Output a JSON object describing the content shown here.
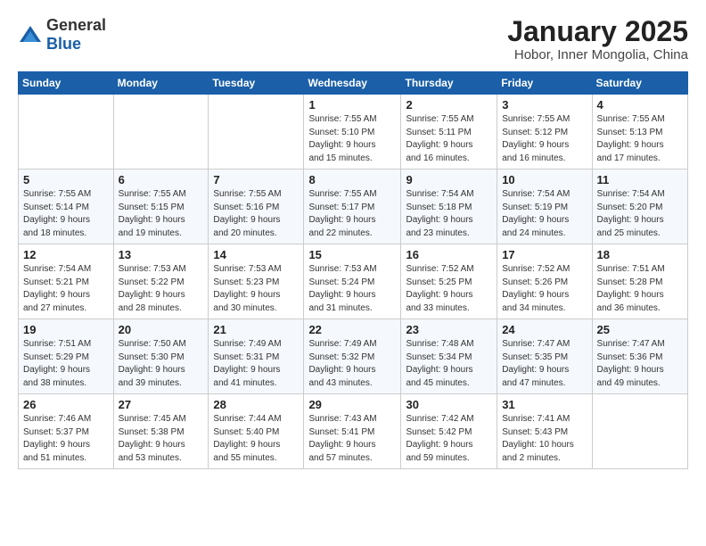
{
  "header": {
    "logo_general": "General",
    "logo_blue": "Blue",
    "title": "January 2025",
    "subtitle": "Hobor, Inner Mongolia, China"
  },
  "calendar": {
    "days_of_week": [
      "Sunday",
      "Monday",
      "Tuesday",
      "Wednesday",
      "Thursday",
      "Friday",
      "Saturday"
    ],
    "weeks": [
      [
        {
          "day": "",
          "info": ""
        },
        {
          "day": "",
          "info": ""
        },
        {
          "day": "",
          "info": ""
        },
        {
          "day": "1",
          "info": "Sunrise: 7:55 AM\nSunset: 5:10 PM\nDaylight: 9 hours\nand 15 minutes."
        },
        {
          "day": "2",
          "info": "Sunrise: 7:55 AM\nSunset: 5:11 PM\nDaylight: 9 hours\nand 16 minutes."
        },
        {
          "day": "3",
          "info": "Sunrise: 7:55 AM\nSunset: 5:12 PM\nDaylight: 9 hours\nand 16 minutes."
        },
        {
          "day": "4",
          "info": "Sunrise: 7:55 AM\nSunset: 5:13 PM\nDaylight: 9 hours\nand 17 minutes."
        }
      ],
      [
        {
          "day": "5",
          "info": "Sunrise: 7:55 AM\nSunset: 5:14 PM\nDaylight: 9 hours\nand 18 minutes."
        },
        {
          "day": "6",
          "info": "Sunrise: 7:55 AM\nSunset: 5:15 PM\nDaylight: 9 hours\nand 19 minutes."
        },
        {
          "day": "7",
          "info": "Sunrise: 7:55 AM\nSunset: 5:16 PM\nDaylight: 9 hours\nand 20 minutes."
        },
        {
          "day": "8",
          "info": "Sunrise: 7:55 AM\nSunset: 5:17 PM\nDaylight: 9 hours\nand 22 minutes."
        },
        {
          "day": "9",
          "info": "Sunrise: 7:54 AM\nSunset: 5:18 PM\nDaylight: 9 hours\nand 23 minutes."
        },
        {
          "day": "10",
          "info": "Sunrise: 7:54 AM\nSunset: 5:19 PM\nDaylight: 9 hours\nand 24 minutes."
        },
        {
          "day": "11",
          "info": "Sunrise: 7:54 AM\nSunset: 5:20 PM\nDaylight: 9 hours\nand 25 minutes."
        }
      ],
      [
        {
          "day": "12",
          "info": "Sunrise: 7:54 AM\nSunset: 5:21 PM\nDaylight: 9 hours\nand 27 minutes."
        },
        {
          "day": "13",
          "info": "Sunrise: 7:53 AM\nSunset: 5:22 PM\nDaylight: 9 hours\nand 28 minutes."
        },
        {
          "day": "14",
          "info": "Sunrise: 7:53 AM\nSunset: 5:23 PM\nDaylight: 9 hours\nand 30 minutes."
        },
        {
          "day": "15",
          "info": "Sunrise: 7:53 AM\nSunset: 5:24 PM\nDaylight: 9 hours\nand 31 minutes."
        },
        {
          "day": "16",
          "info": "Sunrise: 7:52 AM\nSunset: 5:25 PM\nDaylight: 9 hours\nand 33 minutes."
        },
        {
          "day": "17",
          "info": "Sunrise: 7:52 AM\nSunset: 5:26 PM\nDaylight: 9 hours\nand 34 minutes."
        },
        {
          "day": "18",
          "info": "Sunrise: 7:51 AM\nSunset: 5:28 PM\nDaylight: 9 hours\nand 36 minutes."
        }
      ],
      [
        {
          "day": "19",
          "info": "Sunrise: 7:51 AM\nSunset: 5:29 PM\nDaylight: 9 hours\nand 38 minutes."
        },
        {
          "day": "20",
          "info": "Sunrise: 7:50 AM\nSunset: 5:30 PM\nDaylight: 9 hours\nand 39 minutes."
        },
        {
          "day": "21",
          "info": "Sunrise: 7:49 AM\nSunset: 5:31 PM\nDaylight: 9 hours\nand 41 minutes."
        },
        {
          "day": "22",
          "info": "Sunrise: 7:49 AM\nSunset: 5:32 PM\nDaylight: 9 hours\nand 43 minutes."
        },
        {
          "day": "23",
          "info": "Sunrise: 7:48 AM\nSunset: 5:34 PM\nDaylight: 9 hours\nand 45 minutes."
        },
        {
          "day": "24",
          "info": "Sunrise: 7:47 AM\nSunset: 5:35 PM\nDaylight: 9 hours\nand 47 minutes."
        },
        {
          "day": "25",
          "info": "Sunrise: 7:47 AM\nSunset: 5:36 PM\nDaylight: 9 hours\nand 49 minutes."
        }
      ],
      [
        {
          "day": "26",
          "info": "Sunrise: 7:46 AM\nSunset: 5:37 PM\nDaylight: 9 hours\nand 51 minutes."
        },
        {
          "day": "27",
          "info": "Sunrise: 7:45 AM\nSunset: 5:38 PM\nDaylight: 9 hours\nand 53 minutes."
        },
        {
          "day": "28",
          "info": "Sunrise: 7:44 AM\nSunset: 5:40 PM\nDaylight: 9 hours\nand 55 minutes."
        },
        {
          "day": "29",
          "info": "Sunrise: 7:43 AM\nSunset: 5:41 PM\nDaylight: 9 hours\nand 57 minutes."
        },
        {
          "day": "30",
          "info": "Sunrise: 7:42 AM\nSunset: 5:42 PM\nDaylight: 9 hours\nand 59 minutes."
        },
        {
          "day": "31",
          "info": "Sunrise: 7:41 AM\nSunset: 5:43 PM\nDaylight: 10 hours\nand 2 minutes."
        },
        {
          "day": "",
          "info": ""
        }
      ]
    ]
  }
}
